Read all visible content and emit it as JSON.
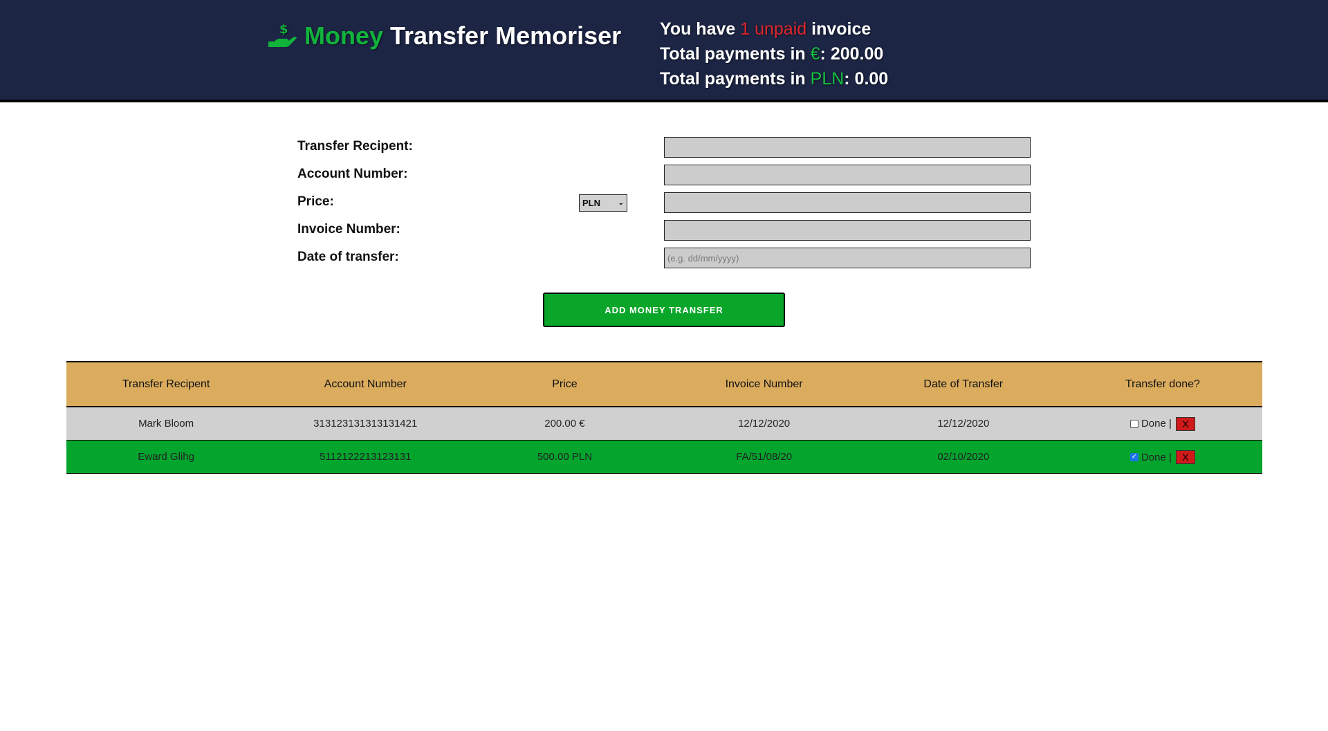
{
  "header": {
    "brand_accent": "Money",
    "brand_rest": "Transfer Memoriser",
    "logo_icon": "hand-dollar-icon",
    "summary": {
      "unpaid_prefix": "You have",
      "unpaid_count_text": "1 unpaid",
      "unpaid_suffix": "invoice",
      "eur_prefix": "Total payments in",
      "eur_currency": "€",
      "eur_value": ": 200.00",
      "pln_prefix": "Total payments in",
      "pln_currency": "PLN",
      "pln_value": ": 0.00"
    }
  },
  "form": {
    "recipient_label": "Transfer Recipent:",
    "account_label": "Account Number:",
    "price_label": "Price:",
    "currency_selected": "PLN",
    "invoice_label": "Invoice Number:",
    "date_label": "Date of transfer:",
    "date_placeholder": "(e.g. dd/mm/yyyy)",
    "add_button": "ADD MONEY TRANSFER"
  },
  "table": {
    "headers": [
      "Transfer Recipent",
      "Account Number",
      "Price",
      "Invoice Number",
      "Date of Transfer",
      "Transfer done?"
    ],
    "rows": [
      {
        "recipient": "Mark Bloom",
        "account": "313123131313131421",
        "price": "200.00 €",
        "invoice": "12/12/2020",
        "date": "12/12/2020",
        "done": false,
        "done_label": "Done |",
        "delete_label": "X"
      },
      {
        "recipient": "Eward Glihg",
        "account": "5112122213123131",
        "price": "500.00 PLN",
        "invoice": "FA/51/08/20",
        "date": "02/10/2020",
        "done": true,
        "done_label": "Done |",
        "delete_label": "X"
      }
    ]
  },
  "colors": {
    "header_bg": "#1c2544",
    "accent_green": "#11b33a",
    "unpaid_red": "#e0262c",
    "table_header_bg": "#dbac5e",
    "paid_row_bg": "#04a52d",
    "unpaid_row_bg": "#d0d0d0"
  }
}
